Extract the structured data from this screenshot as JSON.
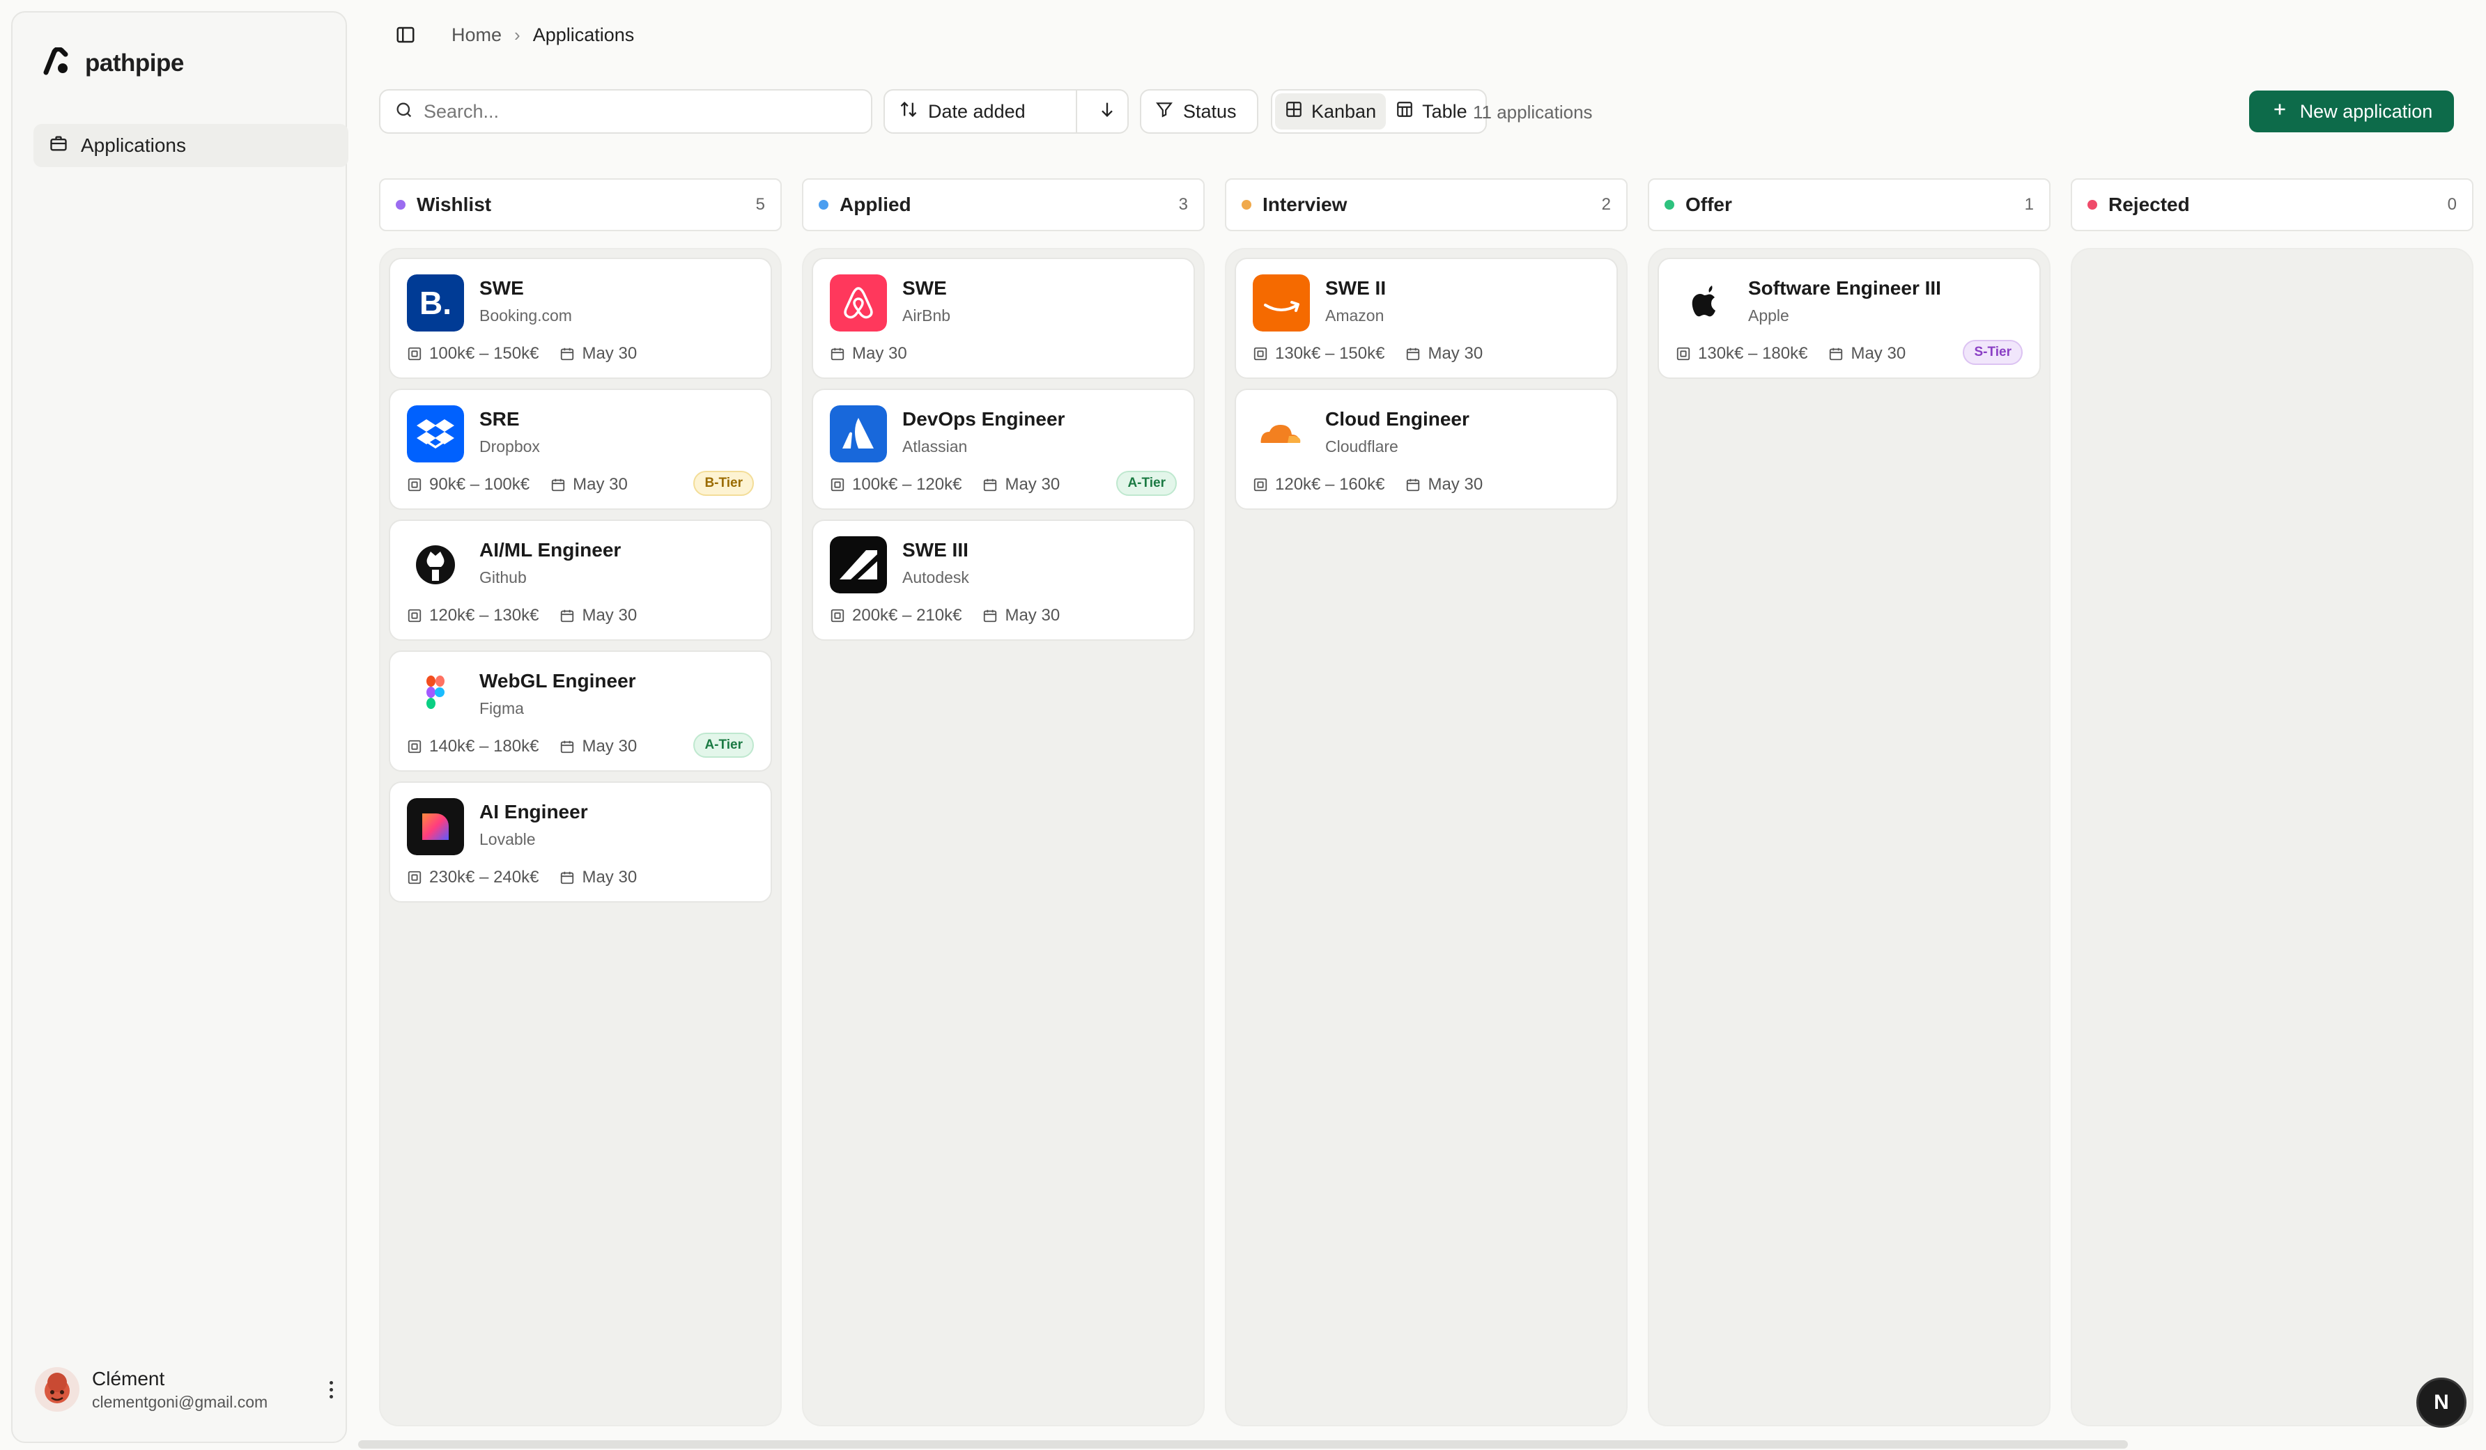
{
  "brand": {
    "name": "pathpipe"
  },
  "sidebar": {
    "items": [
      {
        "label": "Applications",
        "icon": "briefcase-icon",
        "active": true
      }
    ],
    "user": {
      "name": "Clément",
      "email": "clementgoni@gmail.com"
    }
  },
  "breadcrumb": {
    "home": "Home",
    "current": "Applications"
  },
  "toolbar": {
    "search_placeholder": "Search...",
    "sort_label": "Date added",
    "status_label": "Status",
    "view_kanban": "Kanban",
    "view_table": "Table",
    "active_view": "Kanban",
    "count_text": "11 applications",
    "new_button": "New application"
  },
  "columns": [
    {
      "title": "Wishlist",
      "count": "5",
      "color": "#9b6cf0",
      "cards": [
        {
          "role": "SWE",
          "company": "Booking.com",
          "salary": "100k€ – 150k€",
          "date": "May 30",
          "tier": "",
          "logo": "booking"
        },
        {
          "role": "SRE",
          "company": "Dropbox",
          "salary": "90k€ – 100k€",
          "date": "May 30",
          "tier": "B-Tier",
          "logo": "dropbox"
        },
        {
          "role": "AI/ML Engineer",
          "company": "Github",
          "salary": "120k€ – 130k€",
          "date": "May 30",
          "tier": "",
          "logo": "github"
        },
        {
          "role": "WebGL Engineer",
          "company": "Figma",
          "salary": "140k€ – 180k€",
          "date": "May 30",
          "tier": "A-Tier",
          "logo": "figma"
        },
        {
          "role": "AI Engineer",
          "company": "Lovable",
          "salary": "230k€ – 240k€",
          "date": "May 30",
          "tier": "",
          "logo": "lovable"
        }
      ]
    },
    {
      "title": "Applied",
      "count": "3",
      "color": "#4b9ef0",
      "cards": [
        {
          "role": "SWE",
          "company": "AirBnb",
          "salary": "",
          "date": "May 30",
          "tier": "",
          "logo": "airbnb"
        },
        {
          "role": "DevOps Engineer",
          "company": "Atlassian",
          "salary": "100k€ – 120k€",
          "date": "May 30",
          "tier": "A-Tier",
          "logo": "atlassian"
        },
        {
          "role": "SWE III",
          "company": "Autodesk",
          "salary": "200k€ – 210k€",
          "date": "May 30",
          "tier": "",
          "logo": "autodesk"
        }
      ]
    },
    {
      "title": "Interview",
      "count": "2",
      "color": "#f0a94b",
      "cards": [
        {
          "role": "SWE II",
          "company": "Amazon",
          "salary": "130k€ – 150k€",
          "date": "May 30",
          "tier": "",
          "logo": "amazon"
        },
        {
          "role": "Cloud Engineer",
          "company": "Cloudflare",
          "salary": "120k€ – 160k€",
          "date": "May 30",
          "tier": "",
          "logo": "cloudflare"
        }
      ]
    },
    {
      "title": "Offer",
      "count": "1",
      "color": "#2ec27e",
      "cards": [
        {
          "role": "Software Engineer III",
          "company": "Apple",
          "salary": "130k€ – 180k€",
          "date": "May 30",
          "tier": "S-Tier",
          "logo": "apple"
        }
      ]
    },
    {
      "title": "Rejected",
      "count": "0",
      "color": "#ef4b6a",
      "cards": []
    }
  ],
  "tier_colors": {
    "S-Tier": {
      "bg": "#f1e6fb",
      "fg": "#8a3fc4",
      "border": "#dcc3f2"
    },
    "A-Tier": {
      "bg": "#e3f6ea",
      "fg": "#1b7a43",
      "border": "#bfe8cf"
    },
    "B-Tier": {
      "bg": "#fdf3d2",
      "fg": "#9a6b00",
      "border": "#f3dd98"
    }
  },
  "dev_badge": "N"
}
